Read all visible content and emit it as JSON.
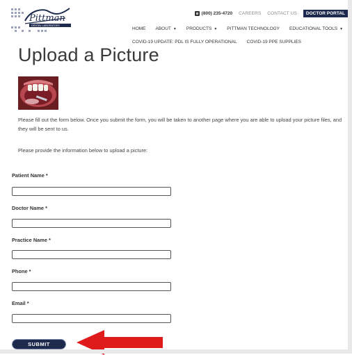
{
  "brand": {
    "logo_script": "Pittman",
    "logo_tagline": "DENTAL LABORATORY"
  },
  "topbar": {
    "phone": "(800) 235-4720",
    "careers": "CAREERS",
    "contact": "CONTACT US",
    "portal": "DOCTOR PORTAL"
  },
  "nav": {
    "items": [
      {
        "label": "HOME",
        "caret": ""
      },
      {
        "label": "ABOUT",
        "caret": "▼"
      },
      {
        "label": "PRODUCTS",
        "caret": "▼"
      },
      {
        "label": "PITTMAN TECHNOLOGY",
        "caret": ""
      },
      {
        "label": "EDUCATIONAL TOOLS",
        "caret": "▼"
      }
    ],
    "sub": [
      {
        "label": "COVID-19 UPDATE: PDL IS FULLY OPERATIONAL"
      },
      {
        "label": "COVID-19 PPE SUPPLIES"
      }
    ]
  },
  "page": {
    "title": "Upload a Picture",
    "intro": "Please fill out the form below. Once you submit the form, you will be taken to another page where you are able to upload your picture files, and they will be sent to us.",
    "instructions": "Please provide the information below to upload a picture:"
  },
  "form": {
    "required_mark": "*",
    "fields": [
      {
        "label": "Patient Name",
        "value": ""
      },
      {
        "label": "Doctor Name",
        "value": ""
      },
      {
        "label": "Practice Name",
        "value": ""
      },
      {
        "label": "Phone",
        "value": ""
      },
      {
        "label": "Email",
        "value": ""
      }
    ],
    "submit_label": "SUBMIT"
  },
  "colors": {
    "navy": "#1d2a4d",
    "arrow_red": "#e01b1b"
  }
}
